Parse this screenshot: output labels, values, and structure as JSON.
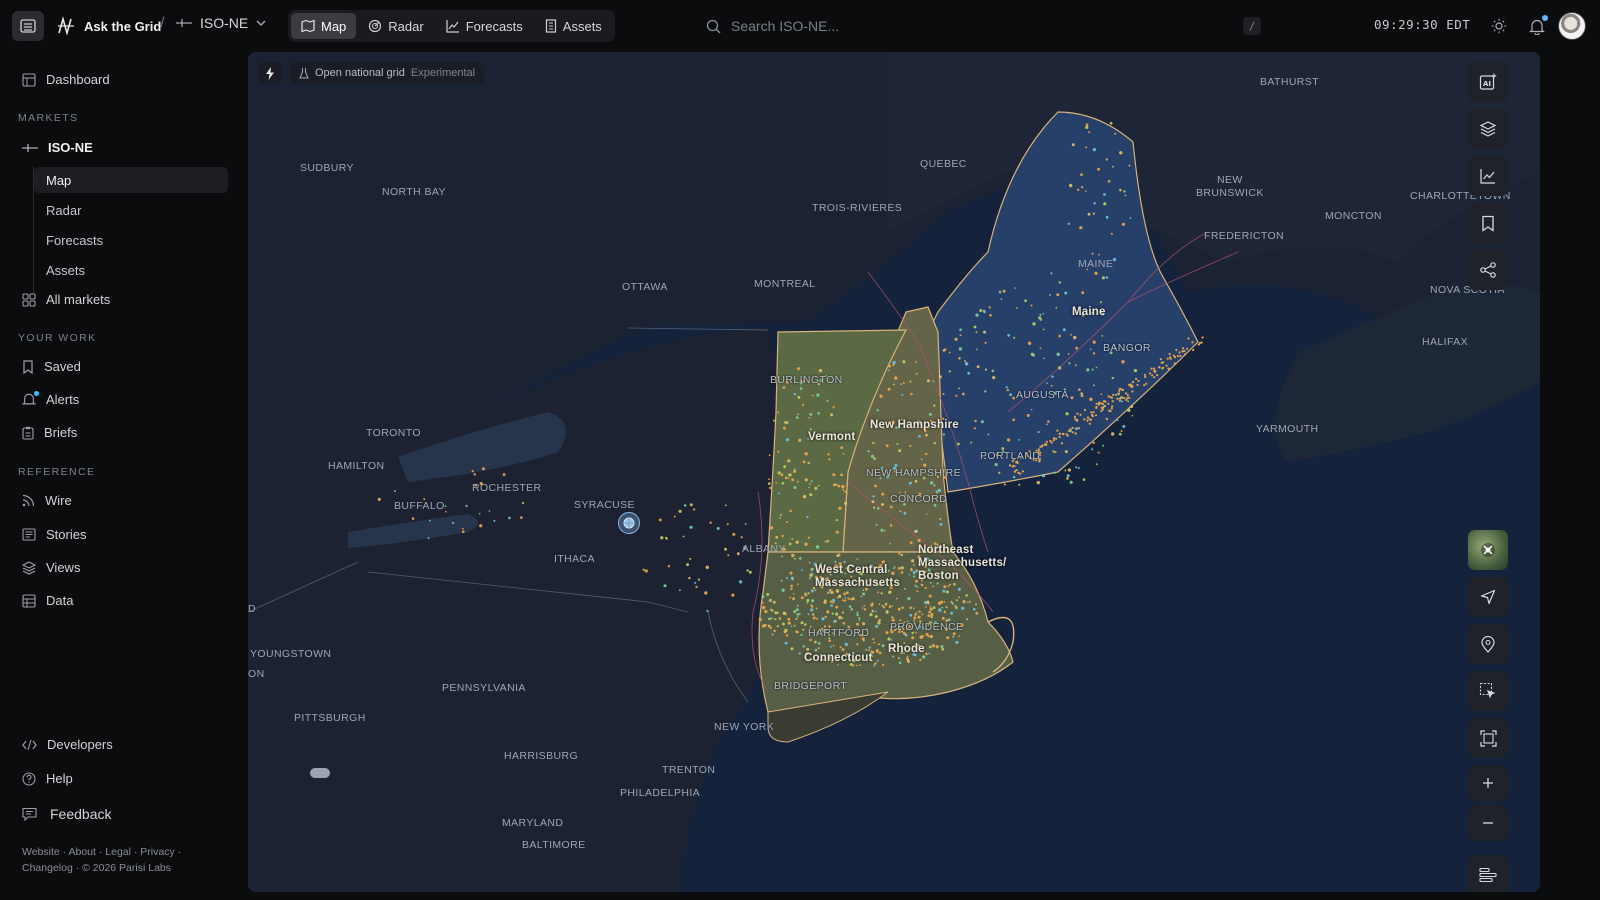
{
  "app": {
    "name": "Ask the Grid"
  },
  "header": {
    "market": "ISO-NE",
    "tabs": [
      {
        "label": "Map",
        "icon": "map-icon",
        "active": true
      },
      {
        "label": "Radar",
        "icon": "radar-icon"
      },
      {
        "label": "Forecasts",
        "icon": "chart-icon"
      },
      {
        "label": "Assets",
        "icon": "building-icon"
      }
    ],
    "search_placeholder": "Search ISO-NE...",
    "shortcut": "/",
    "clock": "09:29:30 EDT"
  },
  "sidebar": {
    "dashboard": "Dashboard",
    "markets_header": "MARKETS",
    "market": "ISO-NE",
    "market_items": [
      "Map",
      "Radar",
      "Forecasts",
      "Assets"
    ],
    "all_markets": "All markets",
    "your_work_header": "YOUR WORK",
    "saved": "Saved",
    "alerts": "Alerts",
    "briefs": "Briefs",
    "reference_header": "REFERENCE",
    "wire": "Wire",
    "stories": "Stories",
    "views": "Views",
    "data": "Data",
    "developers": "Developers",
    "help": "Help",
    "feedback": "Feedback",
    "footer": "Website · About · Legal · Privacy · Changelog · © 2026 Parisi Labs"
  },
  "map": {
    "grid_toggle": "Open national grid",
    "grid_toggle_tag": "Experimental",
    "labels": {
      "sudbury": "SUDBURY",
      "north_bay": "NORTH BAY",
      "quebec": "QUEBEC",
      "trois_rivieres": "TROIS-RIVIERES",
      "ottawa": "OTTAWA",
      "montreal": "MONTREAL",
      "bathurst": "BATHURST",
      "new_brunswick": "NEW\nBRUNSWICK",
      "charlottetown": "CHARLOTTETOWN",
      "moncton": "MONCTON",
      "fredericton": "FREDERICTON",
      "nova_scotia": "NOVA SCOTIA",
      "halifax": "HALIFAX",
      "yarmouth": "YARMOUTH",
      "maine_upper": "MAINE",
      "maine": "Maine",
      "bangor": "BANGOR",
      "augusta": "AUGUSTA",
      "portland": "PORTLAND",
      "burlington": "BURLINGTON",
      "vermont": "Vermont",
      "new_hampshire": "New Hampshire",
      "new_hampshire_upper": "NEW HAMPSHIRE",
      "concord": "CONCORD",
      "toronto": "TORONTO",
      "hamilton": "HAMILTON",
      "rochester": "ROCHESTER",
      "buffalo": "BUFFALO",
      "syracuse": "SYRACUSE",
      "ithaca": "ITHACA",
      "albany": "ALBANY",
      "west_central_ma": "West Central\nMassachusetts",
      "northeast_ma": "Northeast\nMassachusetts/\nBoston",
      "hartford": "HARTFORD",
      "providence": "PROVIDENCE",
      "connecticut": "Connecticut",
      "rhode": "Rhode",
      "bridgeport": "BRIDGEPORT",
      "new_york": "NEW YORK",
      "youngstown": "YOUNGSTOWN",
      "pennsylvania": "PENNSYLVANIA",
      "pittsburgh": "PITTSBURGH",
      "harrisburg": "HARRISBURG",
      "trenton": "TRENTON",
      "philadelphia": "PHILADELPHIA",
      "maryland": "MARYLAND",
      "baltimore": "BALTIMORE",
      "on": "ON",
      "d": "D"
    },
    "colors": {
      "vermont": "#5f6a4a",
      "new_hampshire": "#6b6a4f",
      "maine": "#2f4a6a",
      "southern_ne": "#5a6450",
      "border": "#d9b27a"
    }
  }
}
